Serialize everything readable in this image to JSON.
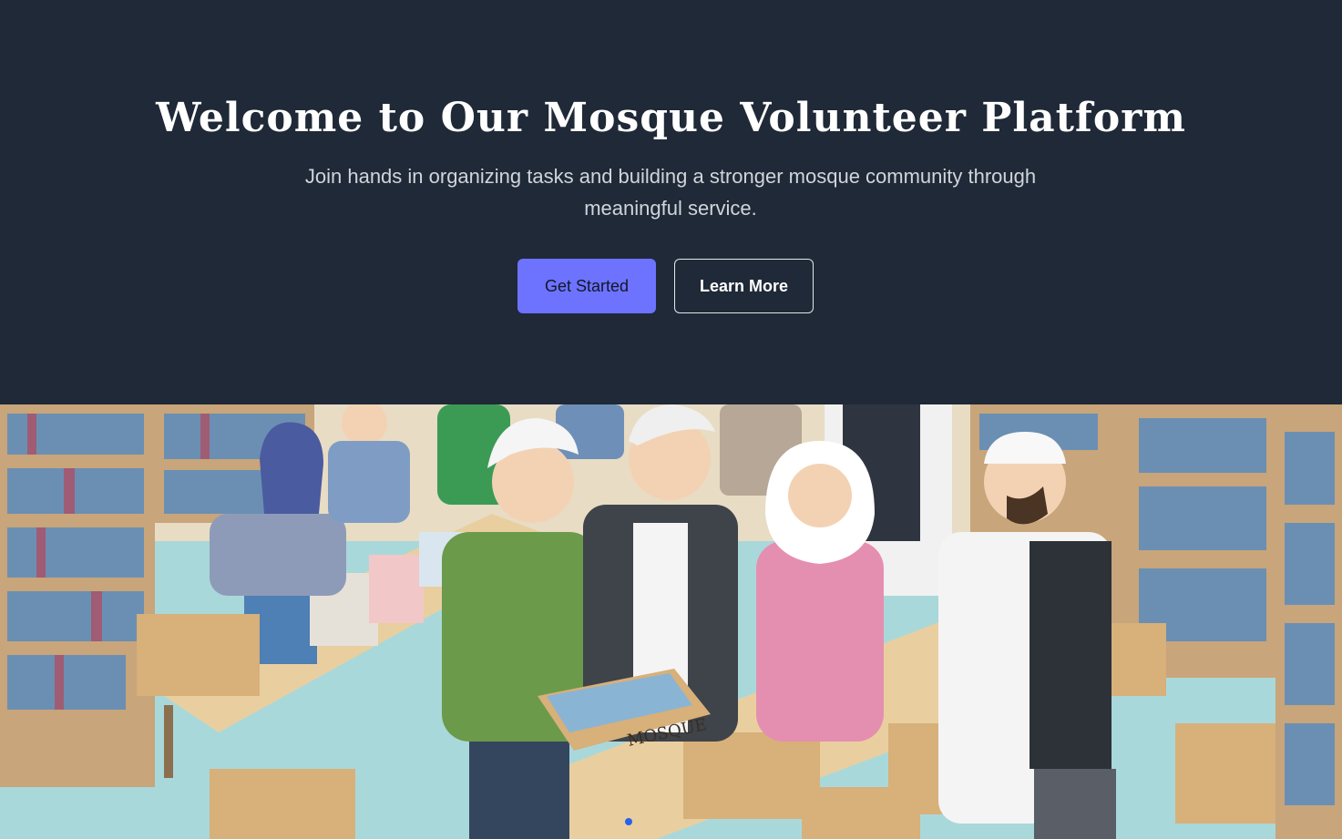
{
  "hero": {
    "title": "Welcome to Our Mosque Volunteer Platform",
    "subtitle": "Join hands in organizing tasks and building a stronger mosque community through meaningful service.",
    "primary_button": "Get Started",
    "secondary_button": "Learn More"
  },
  "illustration": {
    "box_label": "MOSQUE"
  },
  "colors": {
    "background": "#1f2937",
    "accent": "#6d72ff",
    "text_light": "#ffffff",
    "text_muted": "#d1d5db"
  }
}
